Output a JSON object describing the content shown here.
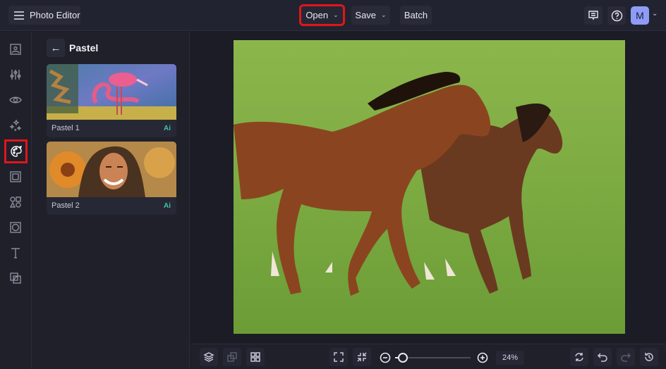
{
  "header": {
    "app_title": "Photo Editor",
    "open_label": "Open",
    "save_label": "Save",
    "batch_label": "Batch",
    "avatar_initial": "M",
    "chevron": "⌄"
  },
  "rail": {
    "items": [
      {
        "name": "image",
        "icon": "image-icon"
      },
      {
        "name": "adjust",
        "icon": "sliders-icon"
      },
      {
        "name": "view",
        "icon": "eye-icon"
      },
      {
        "name": "effects",
        "icon": "sparkle-icon"
      },
      {
        "name": "artsy",
        "icon": "palette-icon",
        "active": true
      },
      {
        "name": "frames",
        "icon": "frame-icon"
      },
      {
        "name": "graphics",
        "icon": "shapes-icon"
      },
      {
        "name": "textures",
        "icon": "texture-icon"
      },
      {
        "name": "text",
        "icon": "text-icon"
      },
      {
        "name": "overlay",
        "icon": "overlay-icon"
      }
    ]
  },
  "panel": {
    "back_icon": "←",
    "title": "Pastel",
    "effects": [
      {
        "label": "Pastel 1",
        "badge": "Ai"
      },
      {
        "label": "Pastel 2",
        "badge": "Ai"
      }
    ]
  },
  "bottom": {
    "zoom_value": "24%",
    "zoom_level_fraction": 0.05
  }
}
